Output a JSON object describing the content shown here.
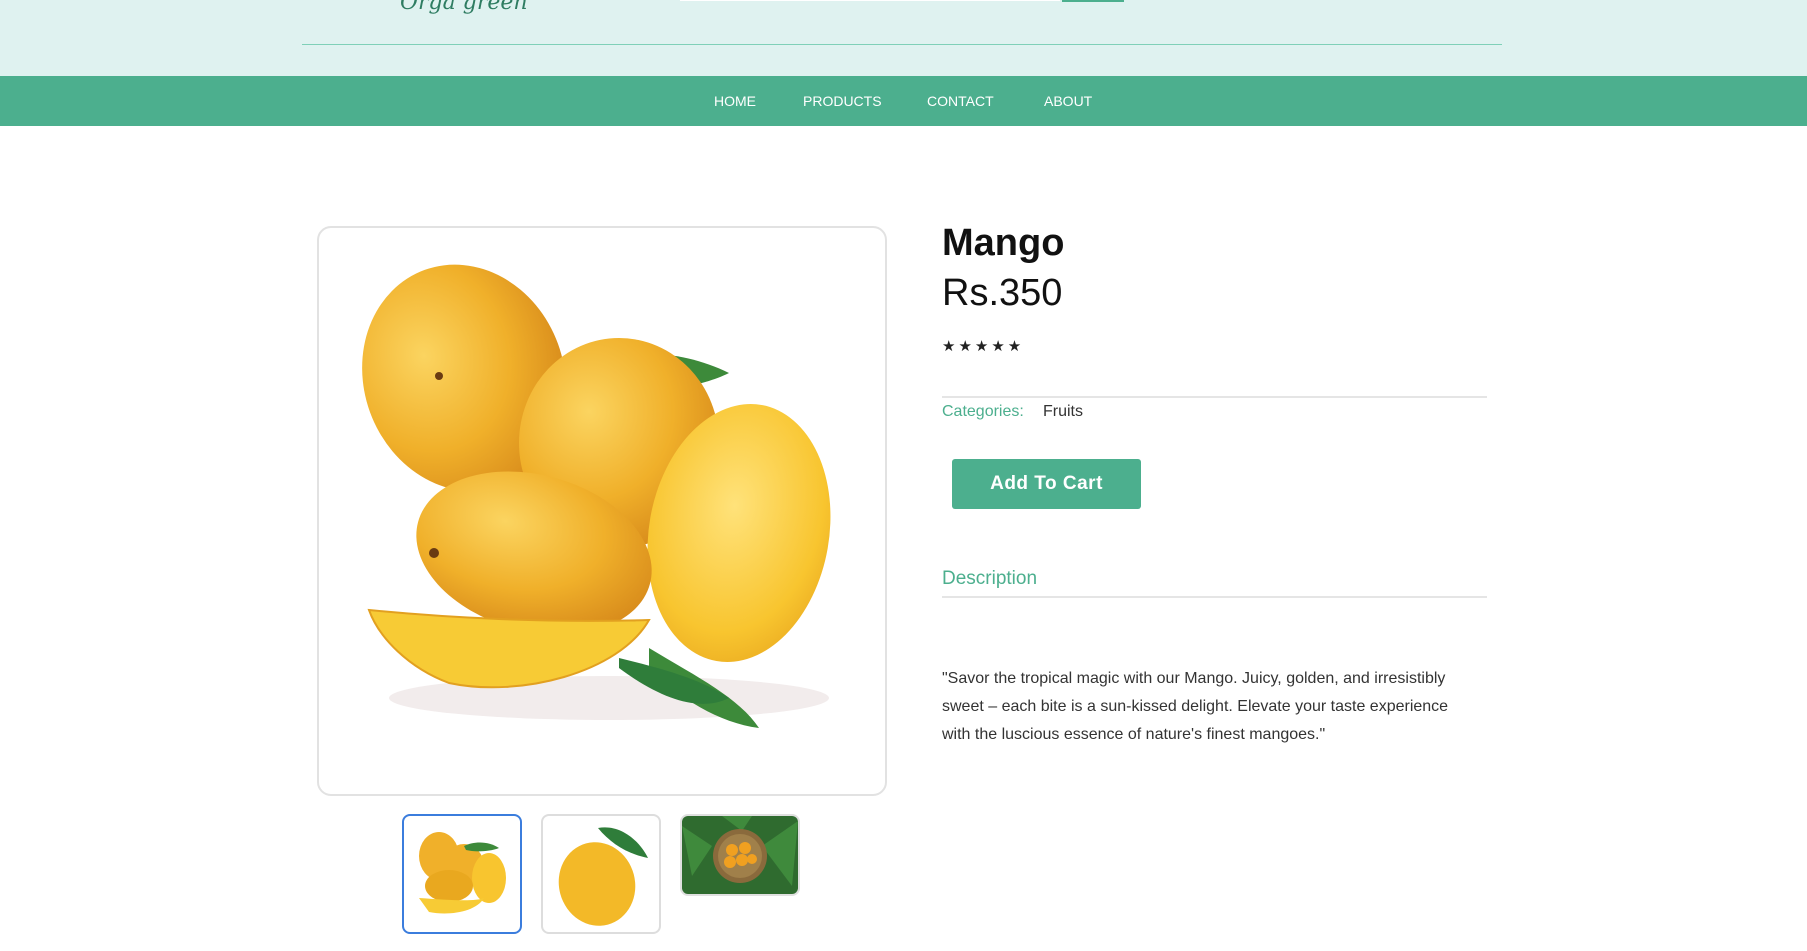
{
  "header": {
    "logo_text": "Orga green"
  },
  "nav": {
    "items": [
      "HOME",
      "PRODUCTS",
      "CONTACT",
      "ABOUT"
    ]
  },
  "product": {
    "title": "Mango",
    "price": "Rs.350",
    "rating_stars": "★★★★★",
    "categories_label": "Categories:",
    "categories_value": "Fruits",
    "add_to_cart_label": "Add To Cart",
    "description_heading": "Description",
    "description_text": "\"Savor the tropical magic with our Mango. Juicy, golden, and irresistibly sweet – each bite is a sun-kissed delight. Elevate your taste experience with the luscious essence of nature's finest mangoes.\""
  },
  "colors": {
    "accent": "#4caf8e",
    "header_bg": "#dff2f0",
    "mango_yellow": "#f3b928",
    "leaf_green": "#2f7d3a"
  }
}
